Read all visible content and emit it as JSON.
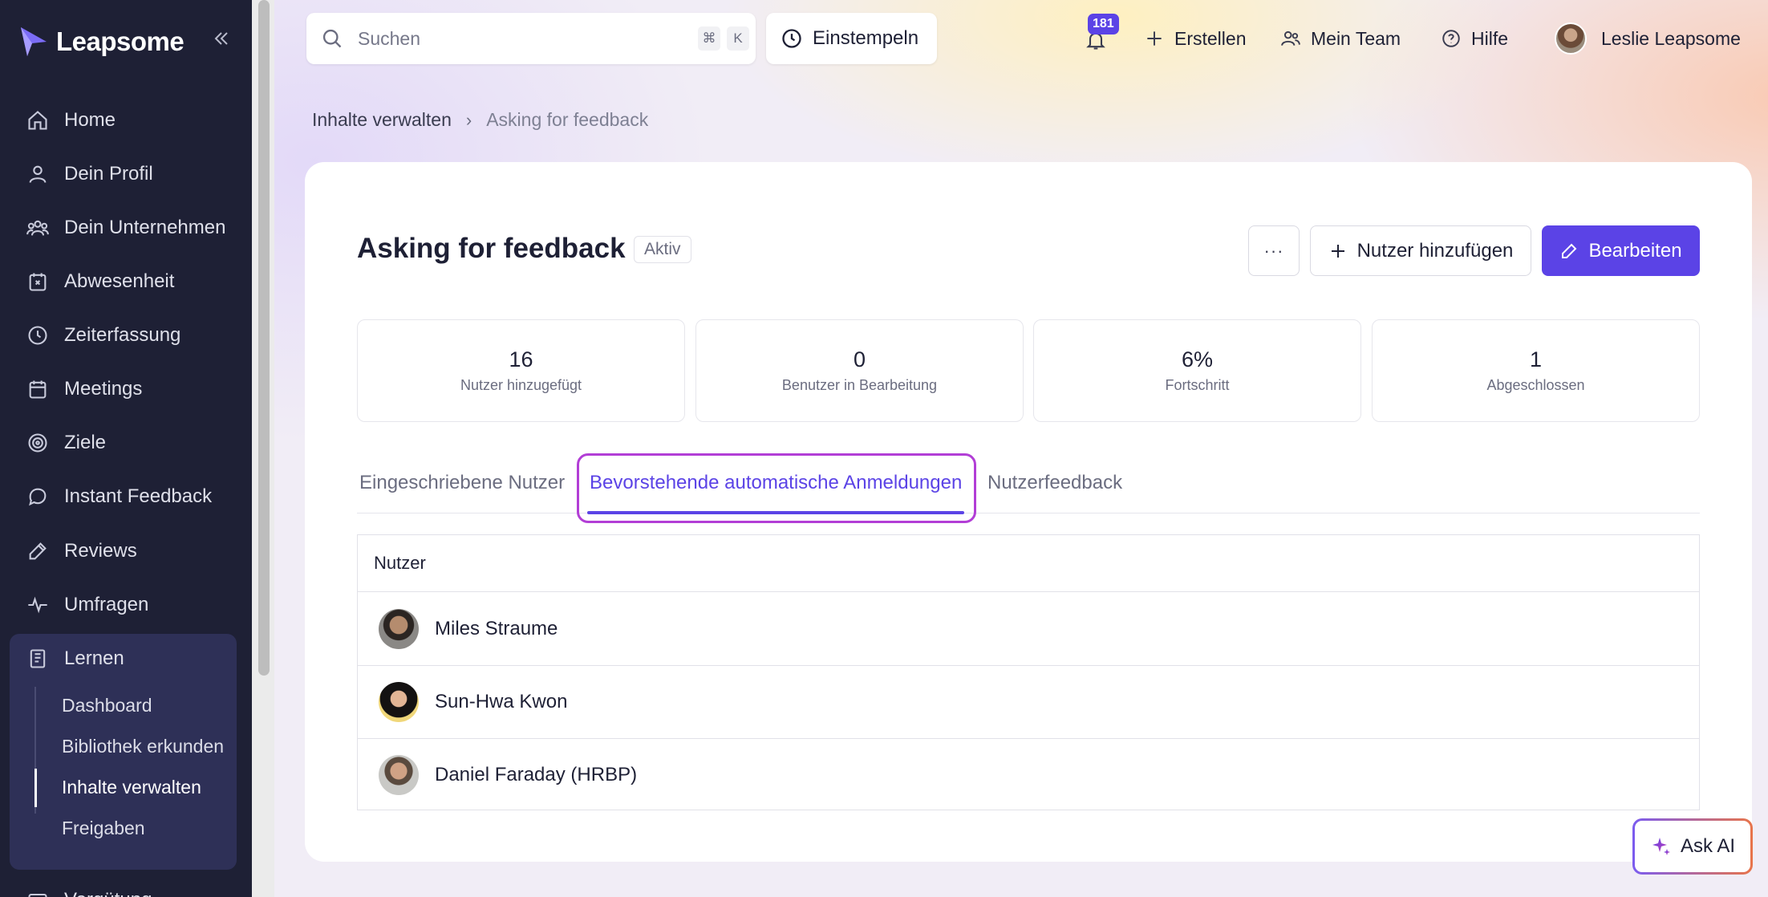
{
  "app": {
    "brand": "Leapsome"
  },
  "sidebar": {
    "items": [
      {
        "label": "Home",
        "icon": "home-icon"
      },
      {
        "label": "Dein Profil",
        "icon": "user-icon"
      },
      {
        "label": "Dein Unternehmen",
        "icon": "users-icon"
      },
      {
        "label": "Abwesenheit",
        "icon": "calendar-x-icon"
      },
      {
        "label": "Zeiterfassung",
        "icon": "clock-icon"
      },
      {
        "label": "Meetings",
        "icon": "calendar-icon"
      },
      {
        "label": "Ziele",
        "icon": "target-icon"
      },
      {
        "label": "Instant Feedback",
        "icon": "chat-icon"
      },
      {
        "label": "Reviews",
        "icon": "pen-icon"
      },
      {
        "label": "Umfragen",
        "icon": "pulse-icon"
      },
      {
        "label": "Lernen",
        "icon": "book-icon"
      }
    ],
    "learn_subitems": [
      {
        "label": "Dashboard"
      },
      {
        "label": "Bibliothek erkunden"
      },
      {
        "label": "Inhalte verwalten",
        "active": true
      },
      {
        "label": "Freigaben"
      }
    ],
    "cut_off_item": "Vergütung"
  },
  "topbar": {
    "search_placeholder": "Suchen",
    "search_shortcut_1": "⌘",
    "search_shortcut_2": "K",
    "clock_in": "Einstempeln",
    "notifications_count": "181",
    "create": "Erstellen",
    "my_team": "Mein Team",
    "help": "Hilfe",
    "user_name": "Leslie Leapsome"
  },
  "breadcrumb": {
    "parent": "Inhalte verwalten",
    "current": "Asking for feedback"
  },
  "page": {
    "title": "Asking for feedback",
    "status": "Aktiv",
    "more_label": "···",
    "add_users": "Nutzer hinzufügen",
    "edit": "Bearbeiten"
  },
  "stats": [
    {
      "value": "16",
      "label": "Nutzer hinzugefügt"
    },
    {
      "value": "0",
      "label": "Benutzer in Bearbeitung"
    },
    {
      "value": "6%",
      "label": "Fortschritt"
    },
    {
      "value": "1",
      "label": "Abgeschlossen"
    }
  ],
  "tabs": [
    {
      "label": "Eingeschriebene Nutzer"
    },
    {
      "label": "Bevorstehende automatische Anmeldungen",
      "active": true
    },
    {
      "label": "Nutzerfeedback"
    }
  ],
  "table": {
    "header": "Nutzer",
    "rows": [
      {
        "name": "Miles Straume"
      },
      {
        "name": "Sun-Hwa Kwon"
      },
      {
        "name": "Daniel Faraday (HRBP)"
      }
    ]
  },
  "ask_ai": "Ask AI",
  "colors": {
    "primary": "#5b43e6",
    "sidebar_bg": "#1e2035",
    "highlight": "#b23ed6"
  }
}
